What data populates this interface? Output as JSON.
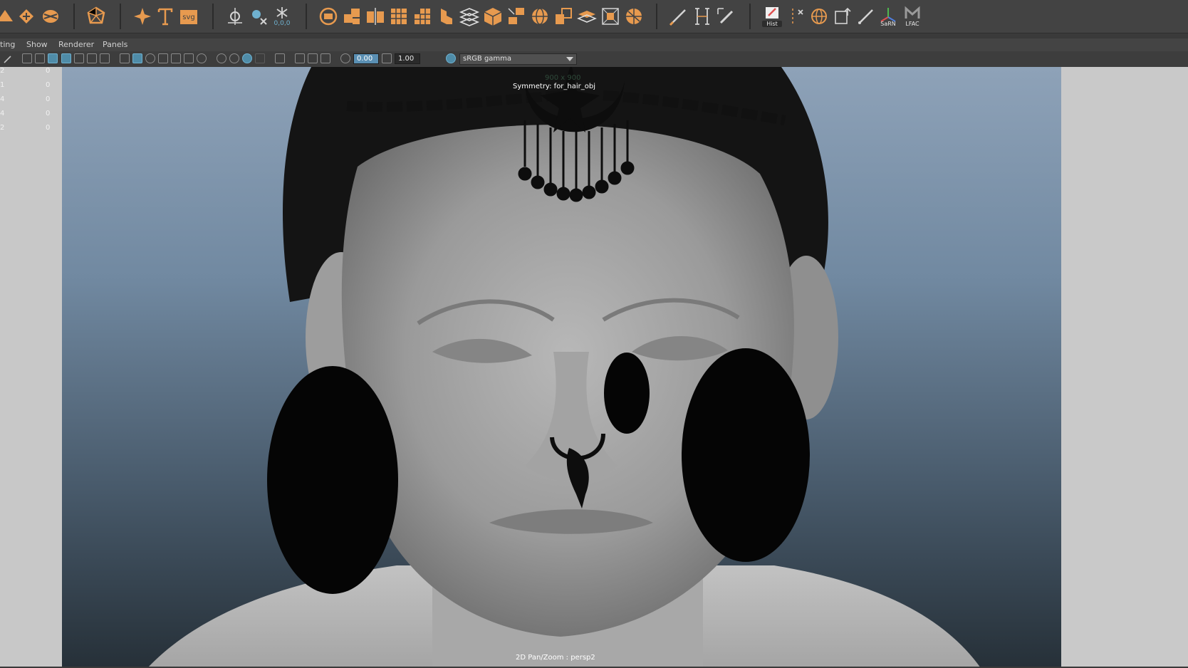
{
  "shelf": {
    "badges": {
      "hist": "Hist",
      "coord": "0,0,0",
      "sarn": "SaRN",
      "lfac": "LFAC",
      "svg": "svg"
    },
    "icons": [
      "poly-cone-icon",
      "diamond-icon",
      "sphere-wire-icon",
      "polyhedron-icon",
      "sparkle-star-icon",
      "text-tool-icon",
      "svg-tool-icon",
      "pivot-icon",
      "snap-scale-icon",
      "freeze-transform-icon",
      "poly-layer-icon",
      "combine-icon",
      "mirror-icon",
      "extrude-grid-icon",
      "bevel-grid-icon",
      "bridge-icon",
      "stack-planes-icon",
      "cube-icon",
      "separate-icon",
      "sphere-grid-icon",
      "boolean-icon",
      "planes-icon",
      "bounding-box-icon",
      "retopo-icon",
      "pencil-curve-icon",
      "bracket-icon",
      "edit-pencil-icon",
      "hist-icon",
      "scatter-icon",
      "sphere-icon",
      "transform-box-icon",
      "brush-icon",
      "sarn-icon",
      "lfac-icon"
    ],
    "accent": "#e79a4f"
  },
  "panel_menu": {
    "items": [
      "ting",
      "Show",
      "Renderer",
      "Panels"
    ]
  },
  "panel_toolbar": {
    "exposure": "0.00",
    "gamma": "1.00",
    "color_space": "sRGB gamma"
  },
  "stats": {
    "rows": [
      [
        "2",
        "0",
        "0"
      ],
      [
        "1",
        "0",
        "0"
      ],
      [
        "4",
        "0",
        "0"
      ],
      [
        "4",
        "0",
        "0"
      ],
      [
        "2",
        "0",
        "0"
      ]
    ]
  },
  "viewport": {
    "resolution": "900 x 900",
    "symmetry": "Symmetry: for_hair_obj",
    "camera": "2D Pan/Zoom : persp2"
  }
}
